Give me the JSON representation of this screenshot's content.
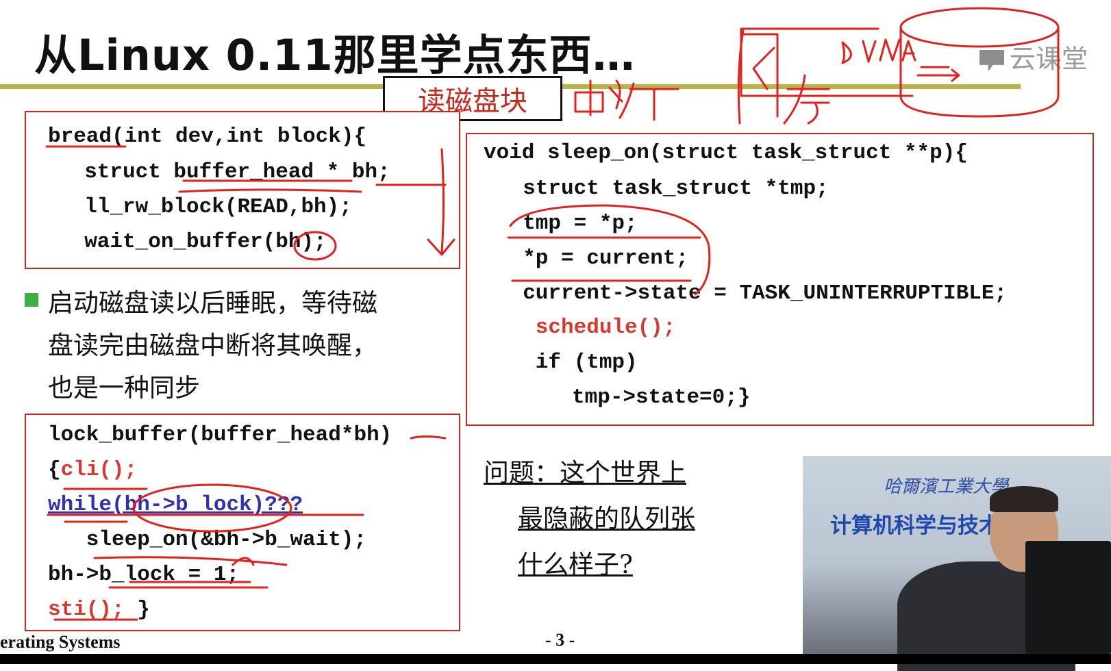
{
  "slide": {
    "title": "从Linux 0.11那里学点东西…",
    "tag": "读磁盘块",
    "logo": "云课堂",
    "bread_code": [
      "bread(int dev,int block){",
      "  struct buffer_head * bh;",
      "  ll_rw_block(READ,bh);",
      "  wait_on_buffer(bh);"
    ],
    "sleep_code": {
      "lines": [
        "void sleep_on(struct task_struct **p){",
        "  struct task_struct *tmp;",
        "  tmp = *p;",
        "  *p = current;",
        "  current->state = TASK_UNINTERRUPTIBLE;"
      ],
      "schedule": "   schedule();",
      "tail": [
        "   if (tmp)",
        "     tmp->state=0;}"
      ]
    },
    "paragraph": [
      "启动磁盘读以后睡眠，等待磁",
      "盘读完由磁盘中断将其唤醒，",
      "也是一种同步"
    ],
    "lock_code": {
      "line1": "lock_buffer(buffer_head*bh)",
      "line2_open": "{",
      "line2_cli": "cli();",
      "line3_while": "while(bh->b_lock)???",
      "line4": "   sleep_on(&bh->b_wait);",
      "line5": "bh->b_lock = 1;",
      "line6_sti": "sti();",
      "line6_close": " }"
    },
    "question": [
      "问题：这个世界上",
      "最隐蔽的队列张",
      "什么样子?"
    ],
    "footer_left": "erating Systems",
    "page_number": "- 3 -"
  },
  "video": {
    "school_logo": "哈爾濱工業大學",
    "department": "计算机科学与技术学院"
  },
  "annotations": {
    "words": [
      "中断",
      "内存",
      "DMA"
    ],
    "ink_color": "#e0211d"
  }
}
